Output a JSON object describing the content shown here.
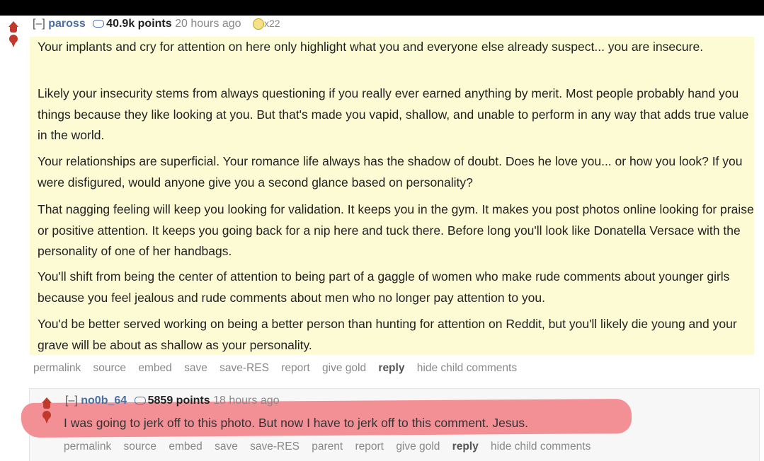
{
  "parent_comment": {
    "toggle": "[–]",
    "author": "paross",
    "points": "40.9k points",
    "time": "20 hours ago",
    "gilded": "x22",
    "paragraphs": [
      "Your implants and cry for attention on here only highlight what you and everyone else already suspect... you are insecure.",
      "Likely your insecurity stems from always questioning if you really ever earned anything by merit. Most people probably hand you things because they like looking at you. But that's made you vapid, shallow, and unable to perform in any way that adds true value in the world.",
      "Your relationships are superficial. Your romance life always has the shadow of doubt. Does he love you... or how you look? If you were disfigured, would anyone give you a second glance based on personality?",
      "That nagging feeling will keep you looking for validation. It keeps you in the gym. It makes you post photos online looking for praise or positive attention. It keeps you going back for a nip here and tuck there. Before long you'll look like Donatella Versace with the personality of one of her handbags.",
      "You'll shift from being the center of attention to being part of a gaggle of women who make rude comments about younger girls because you feel jealous and rude comments about men who no longer pay attention to you.",
      "You'd be better served working on being a better person than hunting for attention on Reddit, but you'll likely die young and your grave will be about as shallow as your personality."
    ],
    "links": [
      "permalink",
      "source",
      "embed",
      "save",
      "save-RES",
      "report",
      "give gold",
      "reply",
      "hide child comments"
    ]
  },
  "child_comment": {
    "toggle": "[–]",
    "author": "no0b_64",
    "points": "5859 points",
    "time": "18 hours ago",
    "text": "I was going to jerk off to this photo. But now I have to jerk off to this comment. Jesus.",
    "links": [
      "permalink",
      "source",
      "embed",
      "save",
      "save-RES",
      "parent",
      "report",
      "give gold",
      "reply",
      "hide child comments"
    ]
  },
  "colors": {
    "highlight": "#f28a8f",
    "comment_bg": "#fcfbd4",
    "vote": "#c0392b"
  }
}
